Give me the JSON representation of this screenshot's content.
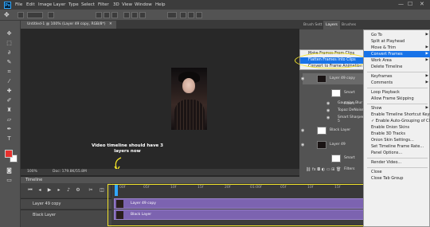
{
  "menubar": {
    "app_icon": "Ps",
    "items": [
      "File",
      "Edit",
      "Image",
      "Layer",
      "Type",
      "Select",
      "Filter",
      "3D",
      "View",
      "Window",
      "Help"
    ],
    "window_controls": [
      "—",
      "☐",
      "✕"
    ]
  },
  "document": {
    "tab_title": "Untitled-1 @ 100% (Layer 49 copy, RGB/8*)",
    "status_zoom": "100%",
    "status_doc": "Doc: 179.8K/55.8M"
  },
  "annotation": {
    "text": "Video timeline should have 3 layers now"
  },
  "timeline": {
    "title": "Timeline",
    "time_ticks": [
      "00f",
      "05f",
      "10f",
      "15f",
      "20f",
      "01:00f",
      "05f",
      "10f",
      "15f"
    ],
    "layers": [
      {
        "name": "Layer 49 copy"
      },
      {
        "name": "Black Layer"
      }
    ],
    "clips": [
      {
        "label": "Layer 49 copy"
      },
      {
        "label": "Black Layer"
      }
    ]
  },
  "panels": {
    "tabs": [
      "Brush Sett",
      "Layers",
      "Brushes"
    ],
    "layers": [
      {
        "name": "Layer 49 copy"
      },
      {
        "name": "Smart Filters"
      },
      {
        "name": "Gaussian Blur"
      },
      {
        "name": "Topaz DeNoise 5"
      },
      {
        "name": "Smart Sharpen"
      },
      {
        "name": "Black Layer"
      },
      {
        "name": "Layer 49"
      },
      {
        "name": "Smart Filters"
      }
    ]
  },
  "submenu": {
    "items": [
      {
        "label": "Make Frames From Clips",
        "highlighted": false
      },
      {
        "label": "Flatten Frames Into Clips",
        "highlighted": true
      },
      {
        "label": "Convert to Frame Animation",
        "highlighted": false
      }
    ]
  },
  "flyout": {
    "items": [
      {
        "label": "Go To",
        "arrow": true,
        "highlighted": false,
        "sep_after": false
      },
      {
        "label": "Split at Playhead",
        "arrow": false,
        "highlighted": false,
        "sep_after": false
      },
      {
        "label": "Move & Trim",
        "arrow": true,
        "highlighted": false,
        "sep_after": false
      },
      {
        "label": "Convert Frames",
        "arrow": true,
        "highlighted": true,
        "sep_after": false
      },
      {
        "label": "Work Area",
        "arrow": true,
        "highlighted": false,
        "sep_after": false
      },
      {
        "label": "Delete Timeline",
        "arrow": false,
        "highlighted": false,
        "sep_after": true
      },
      {
        "label": "Keyframes",
        "arrow": true,
        "highlighted": false,
        "sep_after": false
      },
      {
        "label": "Comments",
        "arrow": true,
        "highlighted": false,
        "sep_after": true
      },
      {
        "label": "Loop Playback",
        "arrow": false,
        "highlighted": false,
        "sep_after": false
      },
      {
        "label": "Allow Frame Skipping",
        "arrow": false,
        "highlighted": false,
        "sep_after": true
      },
      {
        "label": "Show",
        "arrow": true,
        "highlighted": false,
        "sep_after": false
      },
      {
        "label": "Enable Timeline Shortcut Keys",
        "arrow": false,
        "highlighted": false,
        "sep_after": false
      },
      {
        "label": "✓ Enable Auto-Grouping of Clips",
        "arrow": false,
        "highlighted": false,
        "sep_after": false
      },
      {
        "label": "Enable Onion Skins",
        "arrow": false,
        "highlighted": false,
        "sep_after": false
      },
      {
        "label": "Enable 3D Tracks",
        "arrow": false,
        "highlighted": false,
        "sep_after": false
      },
      {
        "label": "Onion Skin Settings...",
        "arrow": false,
        "highlighted": false,
        "sep_after": false
      },
      {
        "label": "Set Timeline Frame Rate...",
        "arrow": false,
        "highlighted": false,
        "sep_after": false
      },
      {
        "label": "Panel Options...",
        "arrow": false,
        "highlighted": false,
        "sep_after": true
      },
      {
        "label": "Render Video...",
        "arrow": false,
        "highlighted": false,
        "sep_after": true
      },
      {
        "label": "Close",
        "arrow": false,
        "highlighted": false,
        "sep_after": false
      },
      {
        "label": "Close Tab Group",
        "arrow": false,
        "highlighted": false,
        "sep_after": false
      }
    ]
  },
  "colors": {
    "annotation_yellow": "#f2e32a",
    "clip_purple": "#7c63b0",
    "menu_highlight": "#1873e8",
    "foreground_color": "#e8312e",
    "background_color": "#ffffff"
  }
}
